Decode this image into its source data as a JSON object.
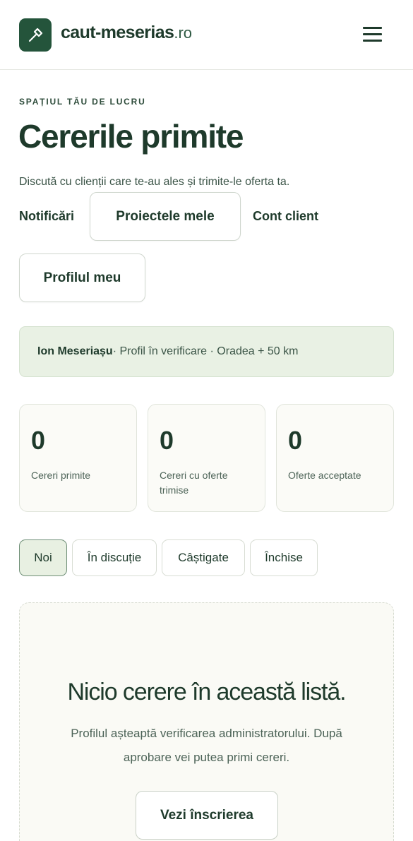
{
  "brand": {
    "name": "caut-meserias",
    "tld": ".ro",
    "color": "#24543b"
  },
  "header": {
    "menu_icon": "hamburger-menu-icon",
    "logo_icon": "hammer-icon"
  },
  "page": {
    "kicker": "SPAȚIUL TĂU DE LUCRU",
    "title": "Cererile primite",
    "subtitle": "Discută cu clienții care te-au ales și trimite-le oferta ta."
  },
  "nav": {
    "notificari": "Notificări",
    "proiecte": "Proiectele mele",
    "cont_client": "Cont client",
    "profil": "Profilul meu"
  },
  "profile": {
    "name": "Ion Meseriașu",
    "details": " · Profil în verificare · Oradea + 50 km",
    "bg_color": "#e9f1e4"
  },
  "stats": [
    {
      "value": "0",
      "label": "Cereri primite"
    },
    {
      "value": "0",
      "label": "Cereri cu oferte trimise"
    },
    {
      "value": "0",
      "label": "Oferte acceptate"
    }
  ],
  "tabs": [
    {
      "label": "Noi",
      "active": true
    },
    {
      "label": "În discuție",
      "active": false
    },
    {
      "label": "Câștigate",
      "active": false
    },
    {
      "label": "Închise",
      "active": false
    }
  ],
  "empty_state": {
    "title": "Nicio cerere în această listă.",
    "text": "Profilul așteaptă verificarea administratorului. După aprobare vei putea primi cereri.",
    "button": "Vezi înscrierea"
  }
}
